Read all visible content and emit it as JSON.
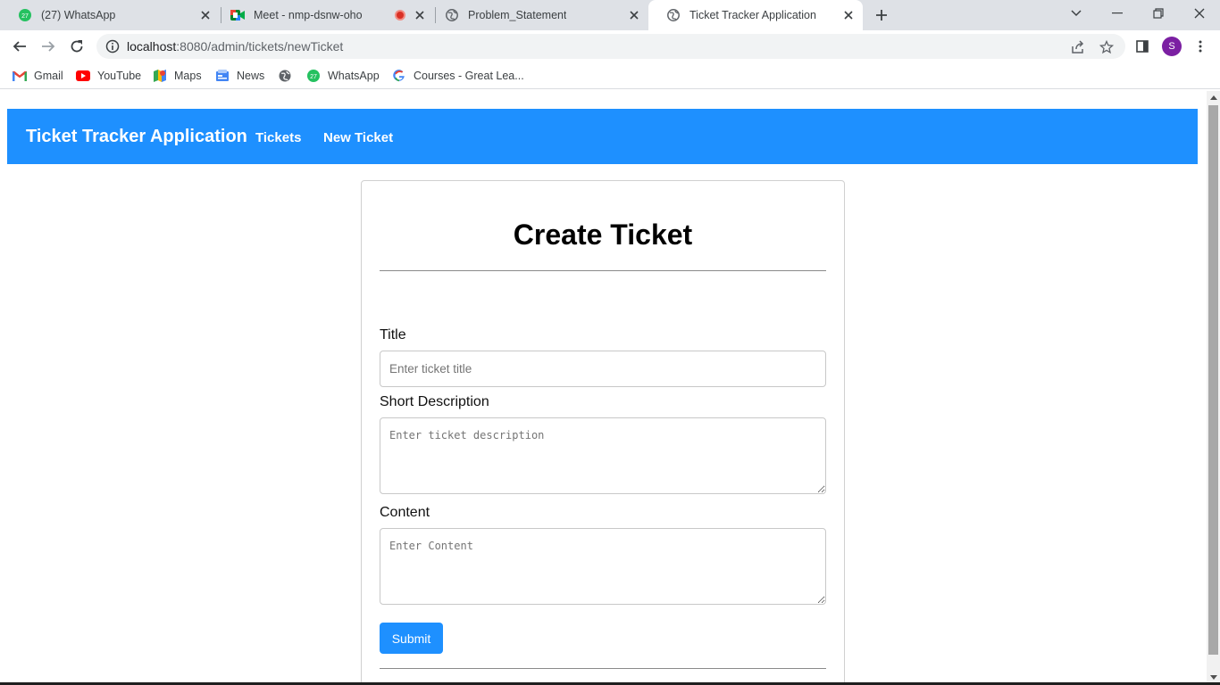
{
  "browser": {
    "tabs": [
      {
        "title": "(27) WhatsApp",
        "icon": "whatsapp-icon",
        "badge": "27"
      },
      {
        "title": "Meet - nmp-dsnw-oho",
        "icon": "google-meet-icon"
      },
      {
        "title": "Problem_Statement",
        "icon": "globe-icon"
      },
      {
        "title": "Ticket Tracker Application",
        "icon": "globe-icon",
        "active": true
      }
    ],
    "address": {
      "host": "localhost",
      "path": ":8080/admin/tickets/newTicket"
    },
    "profile_initial": "S",
    "bookmarks": [
      {
        "label": "Gmail",
        "icon": "gmail-icon"
      },
      {
        "label": "YouTube",
        "icon": "youtube-icon"
      },
      {
        "label": "Maps",
        "icon": "maps-icon"
      },
      {
        "label": "News",
        "icon": "news-icon"
      },
      {
        "label": "",
        "icon": "globe-icon"
      },
      {
        "label": "WhatsApp",
        "icon": "whatsapp-icon",
        "badge": "27"
      },
      {
        "label": "Courses - Great Lea...",
        "icon": "google-icon"
      }
    ]
  },
  "navbar": {
    "brand": "Ticket Tracker Application",
    "links": [
      "Tickets",
      "New Ticket"
    ],
    "color": "#1e90ff"
  },
  "form": {
    "heading": "Create Ticket",
    "title_label": "Title",
    "title_placeholder": "Enter ticket title",
    "title_value": "",
    "description_label": "Short Description",
    "description_placeholder": "Enter ticket description",
    "description_value": "",
    "content_label": "Content",
    "content_placeholder": "Enter Content",
    "content_value": "",
    "submit_label": "Submit",
    "submit_color": "#1e90ff"
  }
}
